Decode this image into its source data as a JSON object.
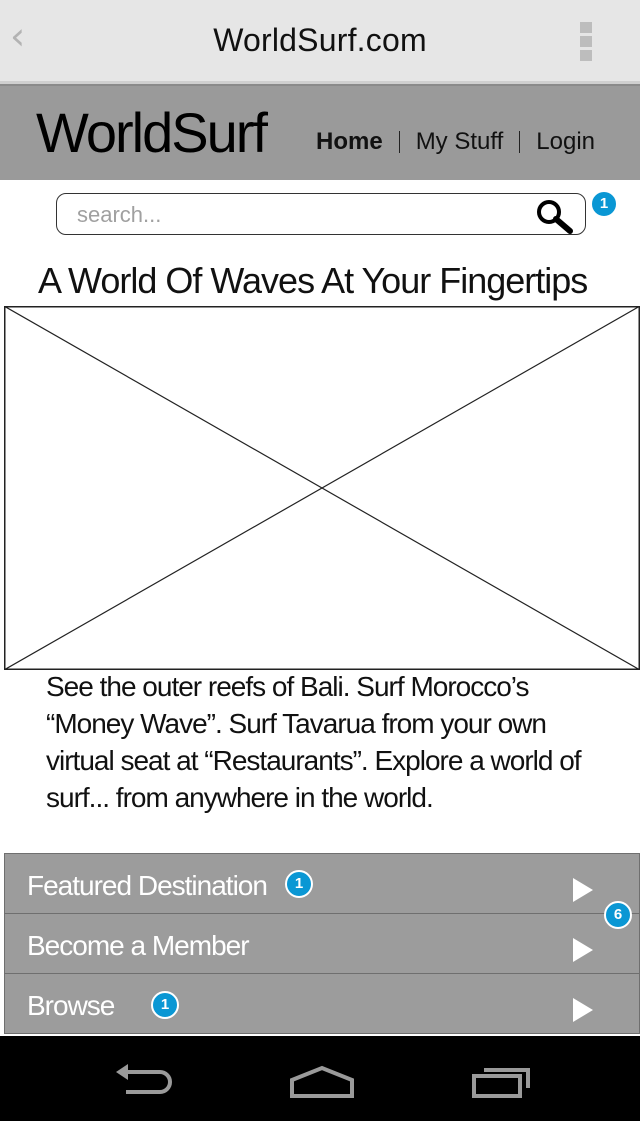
{
  "browser": {
    "title": "WorldSurf.com",
    "back_icon": "chevron-left-icon",
    "menu_icon": "overflow-menu-icon"
  },
  "header": {
    "logo": "WorldSurf",
    "nav": [
      {
        "label": "Home"
      },
      {
        "label": "My Stuff"
      },
      {
        "label": "Login"
      }
    ]
  },
  "search": {
    "placeholder": "search...",
    "badge": "1",
    "icon": "search-icon"
  },
  "main": {
    "headline": "A World Of Waves At Your Fingertips",
    "intro": "See the outer reefs of Bali. Surf Morocco’s “Money Wave”. Surf Tavarua from your own virtual seat at “Restaurants”. Explore a world of surf... from anywhere in the world."
  },
  "menu": {
    "items": [
      {
        "label": "Featured Destination",
        "badge": "1"
      },
      {
        "label": "Become a Member"
      },
      {
        "label": "Browse",
        "badge": "1"
      }
    ],
    "group_badge": "6"
  },
  "android_nav": {
    "icons": [
      "back-icon",
      "home-icon",
      "recent-apps-icon"
    ]
  },
  "colors": {
    "browser_bar": "#e6e6e6",
    "header": "#9a9a9a",
    "menu": "#9c9c9c",
    "badge": "#0a97d4",
    "nav_bar": "#000000"
  }
}
